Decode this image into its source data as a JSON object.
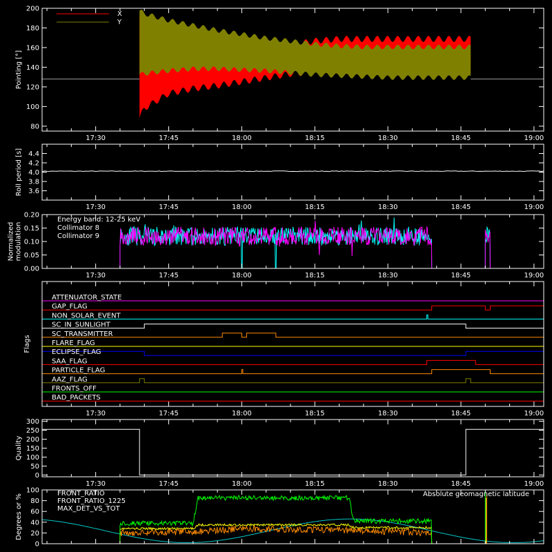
{
  "colors": {
    "background": "#000000",
    "axis": "#ffffff",
    "x_series": "#ff0000",
    "y_series": "#808000",
    "baseline": "#9a9a9a",
    "collimator8": "#00ffff",
    "collimator9": "#ff00ff",
    "front_ratio": "#ffff00",
    "front_ratio_1225": "#00ff00",
    "max_det": "#ff8c00",
    "geomag": "#00c8c8"
  },
  "time_ticks": [
    "17:30",
    "17:45",
    "18:00",
    "18:15",
    "18:30",
    "18:45",
    "19:00"
  ],
  "chart_data": [
    {
      "type": "line",
      "panel": "pointing",
      "ylabel": "Pointing [°]",
      "ylim": [
        75,
        200
      ],
      "yticks": [
        "80",
        "100",
        "120",
        "140",
        "160",
        "180",
        "200"
      ],
      "xlim": [
        "17:19",
        "19:02"
      ],
      "legend": [
        {
          "name": "X",
          "color": "#ff0000"
        },
        {
          "name": "Y",
          "color": "#808000"
        }
      ],
      "baseline_value": 128,
      "active_interval": [
        "17:39",
        "18:47"
      ],
      "envelope_x": {
        "x": [
          "17:39",
          "17:40",
          "17:45",
          "17:50",
          "17:55",
          "18:00",
          "18:05",
          "18:10",
          "18:15",
          "18:20",
          "18:25",
          "18:30",
          "18:35",
          "18:40",
          "18:45",
          "18:47"
        ],
        "upper": [
          195,
          190,
          180,
          174,
          168,
          164,
          163,
          166,
          170,
          172,
          172,
          172,
          172,
          172,
          172,
          172
        ],
        "lower": [
          85,
          95,
          110,
          115,
          118,
          122,
          126,
          130,
          132,
          133,
          133,
          133,
          133,
          133,
          133,
          133
        ]
      },
      "envelope_y": {
        "x": [
          "17:39",
          "17:40",
          "17:45",
          "17:50",
          "17:55",
          "18:00",
          "18:05",
          "18:10",
          "18:15",
          "18:20",
          "18:25",
          "18:30",
          "18:35",
          "18:40",
          "18:45",
          "18:47"
        ],
        "upper": [
          200,
          197,
          190,
          185,
          180,
          176,
          172,
          169,
          166,
          164,
          163,
          163,
          163,
          163,
          163,
          163
        ],
        "lower": [
          130,
          131,
          134,
          136,
          136,
          135,
          134,
          132,
          130,
          129,
          128,
          127,
          127,
          127,
          127,
          127
        ]
      }
    },
    {
      "type": "line",
      "panel": "roll_period",
      "ylabel": "Roll period [s]",
      "ylim": [
        3.4,
        4.6
      ],
      "yticks": [
        "3.6",
        "3.8",
        "4.0",
        "4.2",
        "4.4"
      ],
      "series": [
        {
          "x": [
            "17:19",
            "19:02"
          ],
          "values": [
            4.02,
            4.02
          ]
        }
      ]
    },
    {
      "type": "line",
      "panel": "modulation",
      "ylabel": "Normalized\nmodulation",
      "ylim": [
        0,
        0.2
      ],
      "yticks": [
        "0.00",
        "0.05",
        "0.10",
        "0.15",
        "0.20"
      ],
      "legend": [
        {
          "name": "Energy band: 12-25 keV",
          "color": "#ffffff"
        },
        {
          "name": "Collimator 8",
          "color": "#00ffff"
        },
        {
          "name": "Collimator 9",
          "color": "#ff00ff"
        }
      ],
      "active_intervals": [
        [
          "17:35",
          "18:39"
        ],
        [
          "18:50",
          "18:51"
        ]
      ],
      "mean_value": 0.12,
      "dropouts": [
        "18:00",
        "18:07"
      ]
    },
    {
      "type": "line",
      "panel": "flags",
      "ylabel": "Flags",
      "flags": [
        {
          "name": "ATTENUATOR_STATE",
          "color": "#ff00ff",
          "on": []
        },
        {
          "name": "GAP_FLAG",
          "color": "#ff0000",
          "on": [
            [
              "18:39",
              "18:50"
            ],
            [
              "18:51",
              "19:02"
            ]
          ]
        },
        {
          "name": "NON_SOLAR_EVENT",
          "color": "#00ffff",
          "on": [
            [
              "18:38",
              "18:38"
            ]
          ]
        },
        {
          "name": "SC_IN_SUNLIGHT",
          "color": "#ffffff",
          "on": [
            [
              "17:40",
              "18:46"
            ]
          ]
        },
        {
          "name": "SC_TRANSMITTER",
          "color": "#ff8c00",
          "on": [
            [
              "17:56",
              "17:60"
            ],
            [
              "18:01",
              "18:07"
            ]
          ]
        },
        {
          "name": "FLARE_FLAG",
          "color": "#ffff00",
          "on": []
        },
        {
          "name": "ECLIPSE_FLAG",
          "color": "#0000ff",
          "on": [
            [
              "17:19",
              "17:40"
            ],
            [
              "18:46",
              "19:02"
            ]
          ]
        },
        {
          "name": "SAA_FLAG",
          "color": "#ff0000",
          "on": [
            [
              "18:38",
              "18:48"
            ]
          ]
        },
        {
          "name": "PARTICLE_FLAG",
          "color": "#ff8c00",
          "on": [
            [
              "18:00",
              "18:00"
            ],
            [
              "18:39",
              "18:51"
            ]
          ]
        },
        {
          "name": "AAZ_FLAG",
          "color": "#808000",
          "on": [
            [
              "17:39",
              "17:40"
            ],
            [
              "18:46",
              "18:47"
            ]
          ]
        },
        {
          "name": "FRONTS_OFF",
          "color": "#00ff00",
          "on": []
        },
        {
          "name": "BAD_PACKETS",
          "color": "#ff0000",
          "on": []
        }
      ]
    },
    {
      "type": "line",
      "panel": "quality",
      "ylabel": "Quality",
      "ylim": [
        -10,
        310
      ],
      "yticks": [
        "0",
        "50",
        "100",
        "150",
        "200",
        "250",
        "300"
      ],
      "series": [
        {
          "x": [
            "17:19",
            "17:39",
            "17:39",
            "18:46",
            "18:46",
            "19:02"
          ],
          "values": [
            255,
            255,
            0,
            0,
            255,
            255
          ]
        }
      ]
    },
    {
      "type": "line",
      "panel": "ratios",
      "ylabel": "Degrees or %",
      "ylim": [
        0,
        100
      ],
      "yticks": [
        "0",
        "20",
        "40",
        "60",
        "80",
        "100"
      ],
      "legend": [
        {
          "name": "FRONT_RATIO",
          "color": "#ffff00"
        },
        {
          "name": "FRONT_RATIO_1225",
          "color": "#00ff00"
        },
        {
          "name": "MAX_DET_VS_TOT",
          "color": "#ff8c00"
        }
      ],
      "annotation": "Absolute geomagnetic latitude",
      "series": [
        {
          "name": "FRONT_RATIO",
          "x": [
            "17:35",
            "17:50",
            "17:51",
            "18:22",
            "18:23",
            "18:39"
          ],
          "values": [
            28,
            28,
            35,
            35,
            30,
            30
          ]
        },
        {
          "name": "FRONT_RATIO_1225",
          "x": [
            "17:35",
            "17:50",
            "17:51",
            "18:22",
            "18:23",
            "18:39"
          ],
          "values": [
            38,
            38,
            85,
            85,
            42,
            42
          ]
        },
        {
          "name": "MAX_DET_VS_TOT",
          "x": [
            "17:35",
            "17:50",
            "18:00",
            "18:22",
            "18:39"
          ],
          "values": [
            20,
            22,
            28,
            25,
            20
          ]
        },
        {
          "name": "Absolute geomagnetic latitude",
          "x": [
            "17:19",
            "17:30",
            "17:41",
            "17:52",
            "18:04",
            "18:15",
            "18:26",
            "18:37",
            "18:48",
            "18:59",
            "19:02"
          ],
          "values": [
            45,
            20,
            2,
            28,
            46,
            22,
            2,
            28,
            46,
            40,
            35
          ]
        }
      ]
    }
  ]
}
